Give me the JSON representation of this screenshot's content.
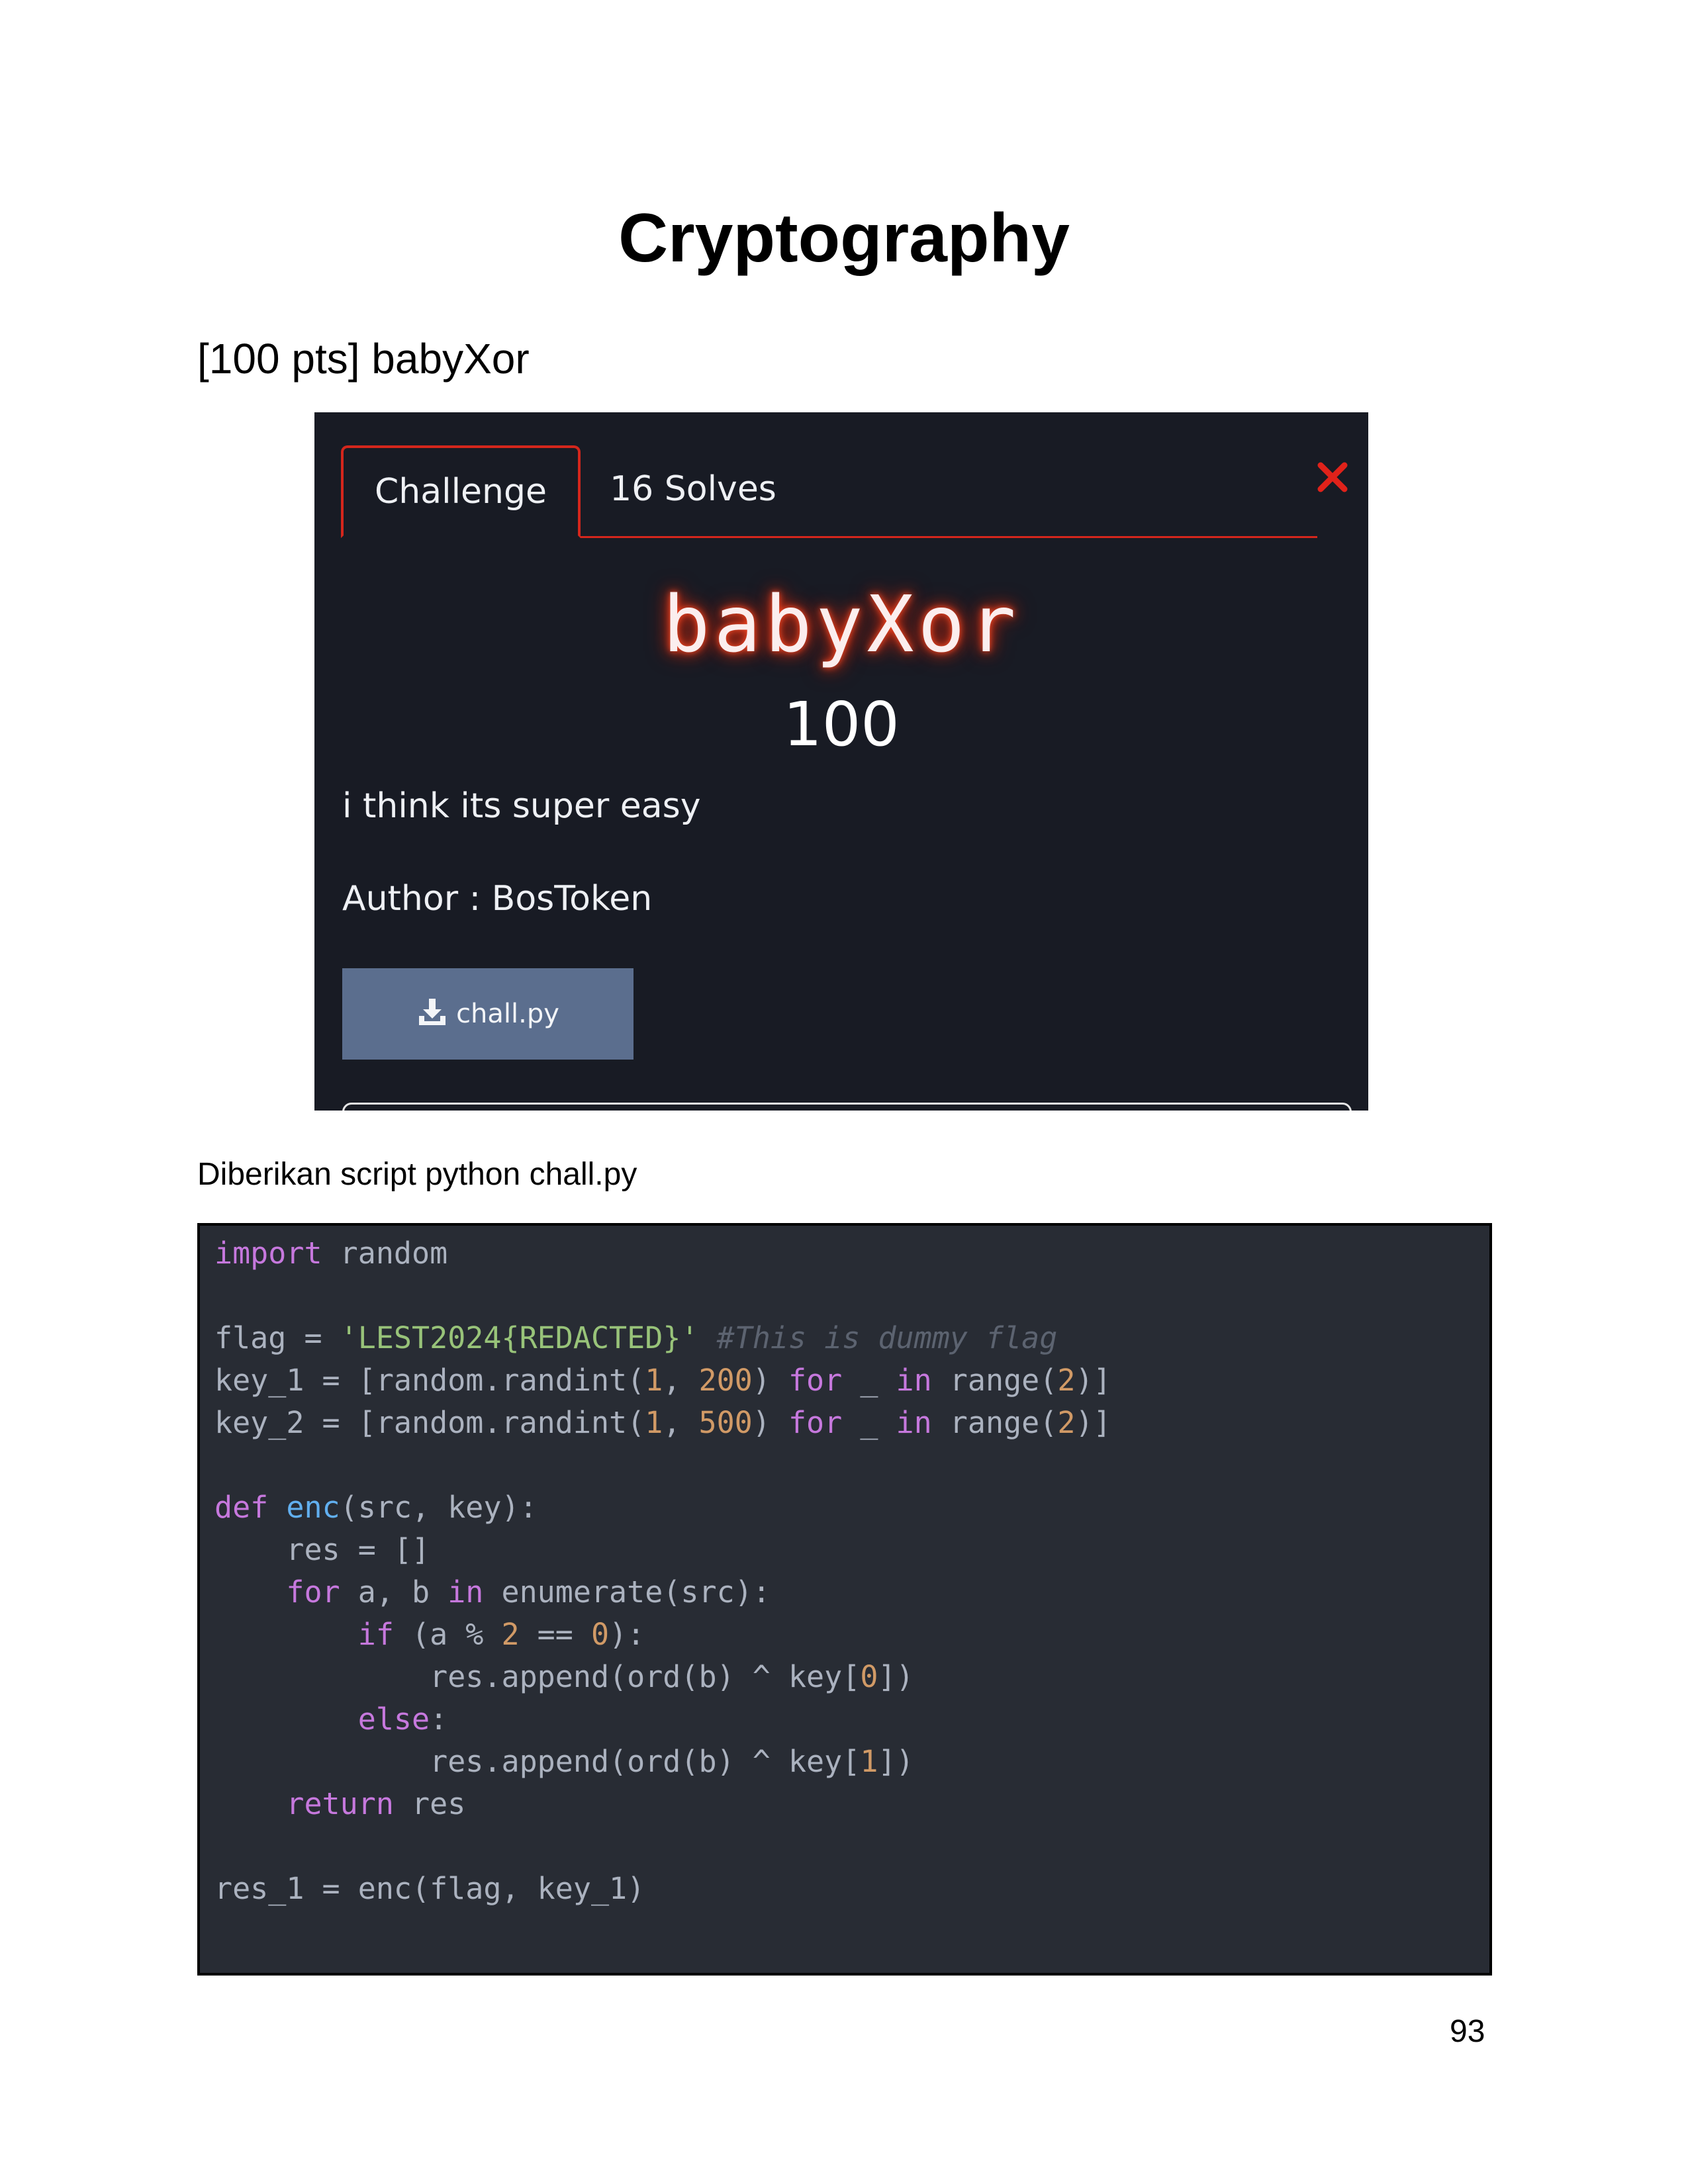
{
  "page": {
    "title": "Cryptography",
    "section_heading": "[100 pts] babyXor",
    "intro_text": "Diberikan script python chall.py",
    "page_number": "93"
  },
  "challenge": {
    "tabs": [
      "Challenge",
      "16 Solves"
    ],
    "close_icon": "close-x-icon",
    "name": "babyXor",
    "points": "100",
    "description": "i think its super easy",
    "author": "Author : BosToken",
    "file_button": {
      "icon": "download-icon",
      "label": "chall.py"
    },
    "colors": {
      "background": "#181b24",
      "accent": "#d4261c",
      "button": "#5b6e8e"
    }
  },
  "code": {
    "language": "python",
    "lines": [
      [
        {
          "t": "import",
          "k": "kw"
        },
        {
          "t": " random",
          "k": "plain"
        }
      ],
      [],
      [
        {
          "t": "flag = ",
          "k": "plain"
        },
        {
          "t": "'LEST2024{REDACTED}'",
          "k": "str"
        },
        {
          "t": " ",
          "k": "plain"
        },
        {
          "t": "#This is dummy flag",
          "k": "com"
        }
      ],
      [
        {
          "t": "key_1 = [random.randint(",
          "k": "plain"
        },
        {
          "t": "1",
          "k": "num"
        },
        {
          "t": ", ",
          "k": "plain"
        },
        {
          "t": "200",
          "k": "num"
        },
        {
          "t": ") ",
          "k": "plain"
        },
        {
          "t": "for",
          "k": "kw"
        },
        {
          "t": " _ ",
          "k": "plain"
        },
        {
          "t": "in",
          "k": "kw"
        },
        {
          "t": " range(",
          "k": "plain"
        },
        {
          "t": "2",
          "k": "num"
        },
        {
          "t": ")]",
          "k": "plain"
        }
      ],
      [
        {
          "t": "key_2 = [random.randint(",
          "k": "plain"
        },
        {
          "t": "1",
          "k": "num"
        },
        {
          "t": ", ",
          "k": "plain"
        },
        {
          "t": "500",
          "k": "num"
        },
        {
          "t": ") ",
          "k": "plain"
        },
        {
          "t": "for",
          "k": "kw"
        },
        {
          "t": " _ ",
          "k": "plain"
        },
        {
          "t": "in",
          "k": "kw"
        },
        {
          "t": " range(",
          "k": "plain"
        },
        {
          "t": "2",
          "k": "num"
        },
        {
          "t": ")]",
          "k": "plain"
        }
      ],
      [],
      [
        {
          "t": "def",
          "k": "kw"
        },
        {
          "t": " ",
          "k": "plain"
        },
        {
          "t": "enc",
          "k": "fn"
        },
        {
          "t": "(src, key):",
          "k": "plain"
        }
      ],
      [
        {
          "t": "    res = []",
          "k": "plain"
        }
      ],
      [
        {
          "t": "    ",
          "k": "plain"
        },
        {
          "t": "for",
          "k": "kw"
        },
        {
          "t": " a, b ",
          "k": "plain"
        },
        {
          "t": "in",
          "k": "kw"
        },
        {
          "t": " enumerate(src):",
          "k": "plain"
        }
      ],
      [
        {
          "t": "        ",
          "k": "plain"
        },
        {
          "t": "if",
          "k": "kw"
        },
        {
          "t": " (a % ",
          "k": "plain"
        },
        {
          "t": "2",
          "k": "num"
        },
        {
          "t": " == ",
          "k": "plain"
        },
        {
          "t": "0",
          "k": "num"
        },
        {
          "t": "):",
          "k": "plain"
        }
      ],
      [
        {
          "t": "            res.append(ord(b) ^ key[",
          "k": "plain"
        },
        {
          "t": "0",
          "k": "num"
        },
        {
          "t": "])",
          "k": "plain"
        }
      ],
      [
        {
          "t": "        ",
          "k": "plain"
        },
        {
          "t": "else",
          "k": "kw"
        },
        {
          "t": ":",
          "k": "plain"
        }
      ],
      [
        {
          "t": "            res.append(ord(b) ^ key[",
          "k": "plain"
        },
        {
          "t": "1",
          "k": "num"
        },
        {
          "t": "])",
          "k": "plain"
        }
      ],
      [
        {
          "t": "    ",
          "k": "plain"
        },
        {
          "t": "return",
          "k": "kw"
        },
        {
          "t": " res",
          "k": "plain"
        }
      ],
      [],
      [
        {
          "t": "res_1 = enc(flag, key_1)",
          "k": "plain"
        }
      ]
    ],
    "colors": {
      "background": "#282c34",
      "keyword": "#c678dd",
      "function": "#61afef",
      "number": "#d19a66",
      "string": "#98c379",
      "comment": "#5c6370",
      "text": "#abb2bf"
    }
  }
}
